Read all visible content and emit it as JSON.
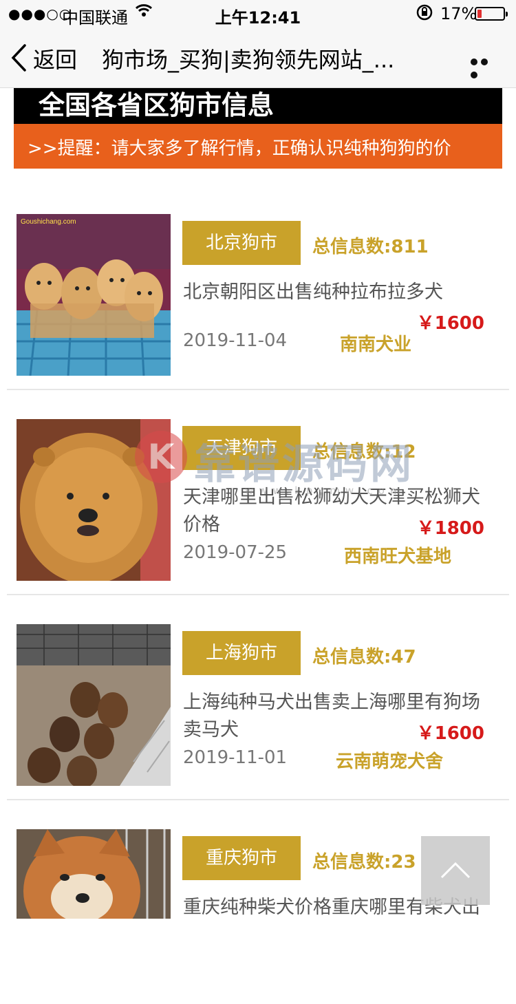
{
  "status_bar": {
    "signal": "●●●○○",
    "carrier": "中国联通",
    "time": "上午12:41",
    "battery_percent": "17%",
    "battery_level": 0.17,
    "battery_color": "#e03030"
  },
  "nav": {
    "back_label": "返回",
    "title": "狗市场_买狗|卖狗领先网站_...",
    "icons": [
      "chevron-left-icon",
      "more-icon"
    ]
  },
  "header": {
    "title": "全国各省区狗市信息",
    "notice": ">>提醒：请大家多了解行情，正确认识纯种狗狗的价"
  },
  "listings": [
    {
      "tag": "北京狗市",
      "count": "总信息数:811",
      "title": "北京朝阳区出售纯种拉布拉多犬",
      "price": "￥1600",
      "date": "2019-11-04",
      "seller": "南南犬业",
      "image_caption": "Goushichang.com"
    },
    {
      "tag": "天津狗市",
      "count": "总信息数:12",
      "title": "天津哪里出售松狮幼犬天津买松狮犬价格",
      "price": "￥1800",
      "date": "2019-07-25",
      "seller": "西南旺犬基地"
    },
    {
      "tag": "上海狗市",
      "count": "总信息数:47",
      "title": "上海纯种马犬出售卖上海哪里有狗场卖马犬",
      "price": "￥1600",
      "date": "2019-11-01",
      "seller": "云南萌宠犬舍"
    },
    {
      "tag": "重庆狗市",
      "count": "总信息数:23",
      "title": "重庆纯种柴犬价格重庆哪里有柴犬出"
    }
  ],
  "watermark": {
    "logo_letter": "K",
    "text": "靠谱源码网",
    "url": "www.kpymw.com"
  },
  "colors": {
    "accent_gold": "#c9a22a",
    "notice_orange": "#e8601c",
    "price_red": "#d61a1a"
  }
}
